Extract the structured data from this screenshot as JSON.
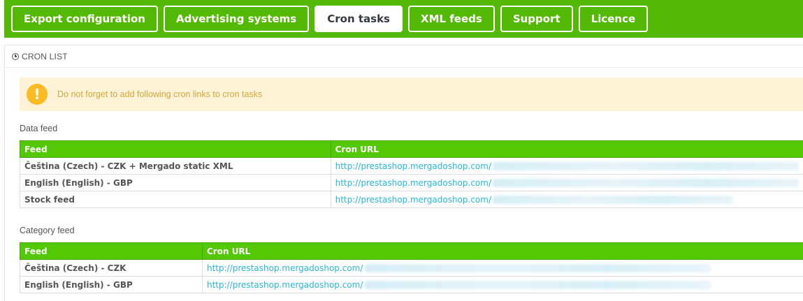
{
  "tabs": [
    {
      "label": "Export configuration",
      "active": false
    },
    {
      "label": "Advertising systems",
      "active": false
    },
    {
      "label": "Cron tasks",
      "active": true
    },
    {
      "label": "XML feeds",
      "active": false
    },
    {
      "label": "Support",
      "active": false
    },
    {
      "label": "Licence",
      "active": false
    }
  ],
  "panel": {
    "heading": "CRON LIST",
    "heading_icon": "clock-icon"
  },
  "alert": {
    "icon": "warning-icon",
    "text": "Do not forget to add following cron links to cron tasks"
  },
  "data_feed": {
    "title": "Data feed",
    "columns": [
      "Feed",
      "Cron URL"
    ],
    "rows": [
      {
        "feed": "Čeština (Czech) - CZK + Mergado static XML",
        "url": "http://prestashop.mergadoshop.com/"
      },
      {
        "feed": "English (English) - GBP",
        "url": "http://prestashop.mergadoshop.com/"
      },
      {
        "feed": "Stock feed",
        "url": "http://prestashop.mergadoshop.com/"
      }
    ]
  },
  "category_feed": {
    "title": "Category feed",
    "columns": [
      "Feed",
      "Cron URL"
    ],
    "rows": [
      {
        "feed": "Čeština (Czech) - CZK",
        "url": "http://prestashop.mergadoshop.com/"
      },
      {
        "feed": "English (English) - GBP",
        "url": "http://prestashop.mergadoshop.com/"
      }
    ]
  },
  "colors": {
    "brand_green": "#53b905",
    "table_header_green": "#53c905",
    "link_blue": "#25b9d7",
    "alert_bg": "#fff3d7",
    "alert_icon": "#fbbb22"
  }
}
